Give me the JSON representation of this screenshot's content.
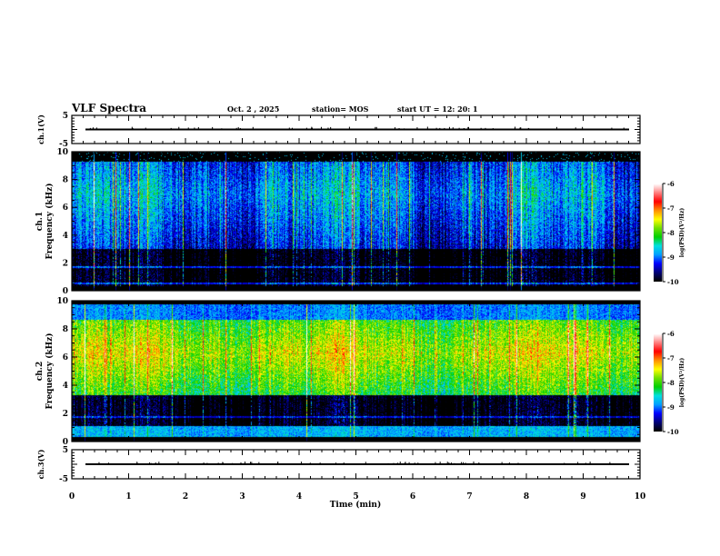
{
  "header": {
    "title": "VLF Spectra",
    "date": "Oct. 2  , 2025",
    "station": "station= MOS",
    "start": "start  UT =    12: 20: 1"
  },
  "chart_data": {
    "type": "heatmap",
    "xlabel": "Time  (min)",
    "xlim": [
      0,
      10
    ],
    "xticks": [
      "0",
      "1",
      "2",
      "3",
      "4",
      "5",
      "6",
      "7",
      "8",
      "9",
      "10"
    ],
    "panels": [
      {
        "id": "ch1-voltage",
        "type": "line",
        "ylabel": "ch.1(V)",
        "ylim": [
          -5,
          5
        ],
        "yticks": [
          "5",
          "-5"
        ],
        "baseline": 0
      },
      {
        "id": "ch1-spectrogram",
        "type": "heatmap",
        "ylabel_top": "ch.1",
        "ylabel": "Frequency  (kHz)",
        "ylim": [
          0,
          10
        ],
        "yticks": [
          "0",
          "2",
          "4",
          "6",
          "8",
          "10"
        ],
        "colorbar": {
          "label": "log(PSD)(V²/Hz)",
          "range": [
            -10,
            -6
          ],
          "ticks": [
            "-6",
            "-7",
            "-8",
            "-9",
            "-10"
          ]
        }
      },
      {
        "id": "ch2-spectrogram",
        "type": "heatmap",
        "ylabel_top": "ch.2",
        "ylabel": "Frequency  (kHz)",
        "ylim": [
          0,
          10
        ],
        "yticks": [
          "0",
          "2",
          "4",
          "6",
          "8",
          "10"
        ],
        "colorbar": {
          "label": "log(PSD)(V²/Hz)",
          "range": [
            -10,
            -6
          ],
          "ticks": [
            "-6",
            "-7",
            "-8",
            "-9",
            "-10"
          ]
        }
      },
      {
        "id": "ch3-voltage",
        "type": "line",
        "ylabel": "ch.3(V)",
        "ylim": [
          -5,
          5
        ],
        "yticks": [
          "5",
          "-5"
        ],
        "baseline": 0
      }
    ],
    "colormap": [
      "#000000",
      "#00007a",
      "#0000ff",
      "#00a0ff",
      "#00e0e0",
      "#00d000",
      "#70e000",
      "#ffff00",
      "#ff9000",
      "#ff0000",
      "#ff8080",
      "#ffffff"
    ]
  }
}
